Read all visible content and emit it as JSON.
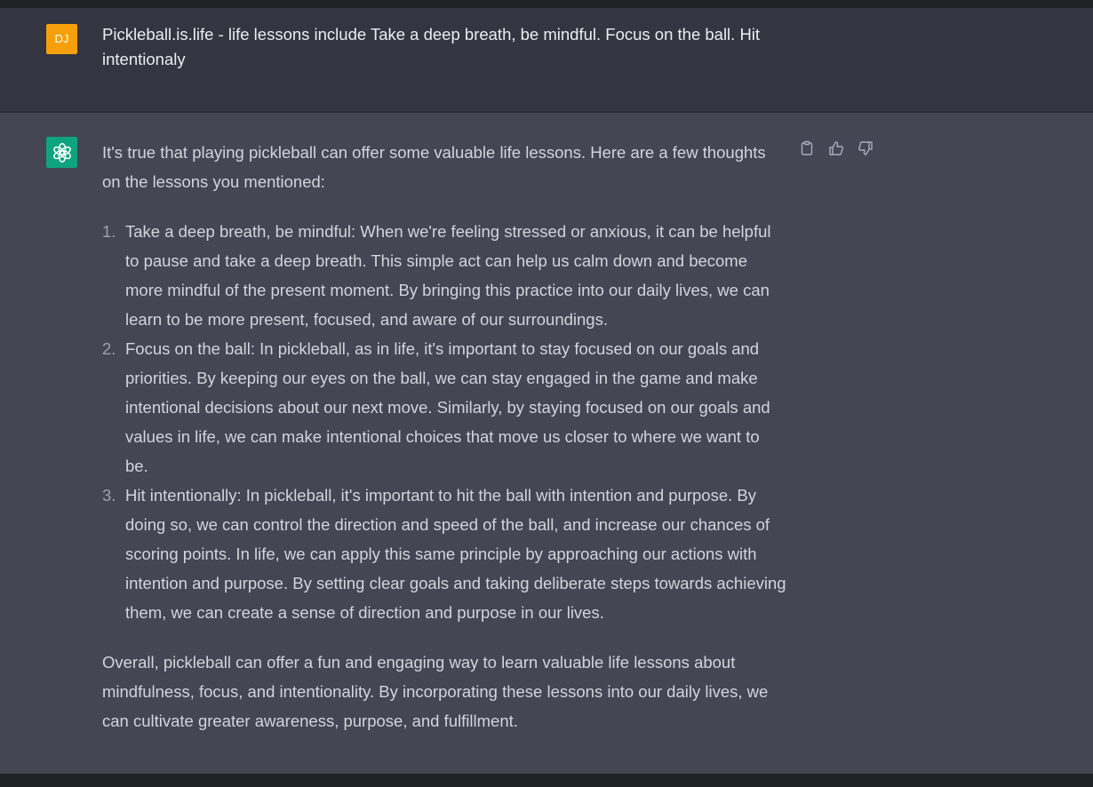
{
  "user_message": {
    "avatar_initials": "DJ",
    "text": "Pickleball.is.life - life lessons include Take a deep breath, be mindful. Focus on the ball. Hit intentionaly"
  },
  "assistant_message": {
    "avatar_icon": "openai-logo-icon",
    "intro": "It's true that playing pickleball can offer some valuable life lessons. Here are a few thoughts on the lessons you mentioned:",
    "items": [
      {
        "number": "1.",
        "text": "Take a deep breath, be mindful: When we're feeling stressed or anxious, it can be helpful to pause and take a deep breath. This simple act can help us calm down and become more mindful of the present moment. By bringing this practice into our daily lives, we can learn to be more present, focused, and aware of our surroundings."
      },
      {
        "number": "2.",
        "text": "Focus on the ball: In pickleball, as in life, it's important to stay focused on our goals and priorities. By keeping our eyes on the ball, we can stay engaged in the game and make intentional decisions about our next move. Similarly, by staying focused on our goals and values in life, we can make intentional choices that move us closer to where we want to be."
      },
      {
        "number": "3.",
        "text": "Hit intentionally: In pickleball, it's important to hit the ball with intention and purpose. By doing so, we can control the direction and speed of the ball, and increase our chances of scoring points. In life, we can apply this same principle by approaching our actions with intention and purpose. By setting clear goals and taking deliberate steps towards achieving them, we can create a sense of direction and purpose in our lives."
      }
    ],
    "conclusion": "Overall, pickleball can offer a fun and engaging way to learn valuable life lessons about mindfulness, focus, and intentionality. By incorporating these lessons into our daily lives, we can cultivate greater awareness, purpose, and fulfillment.",
    "actions": [
      "copy-icon",
      "thumbs-up-icon",
      "thumbs-down-icon"
    ]
  },
  "colors": {
    "user_avatar": "#f5a00a",
    "bot_avatar": "#10a37f",
    "user_row_bg": "#343541",
    "assistant_row_bg": "#444654"
  }
}
